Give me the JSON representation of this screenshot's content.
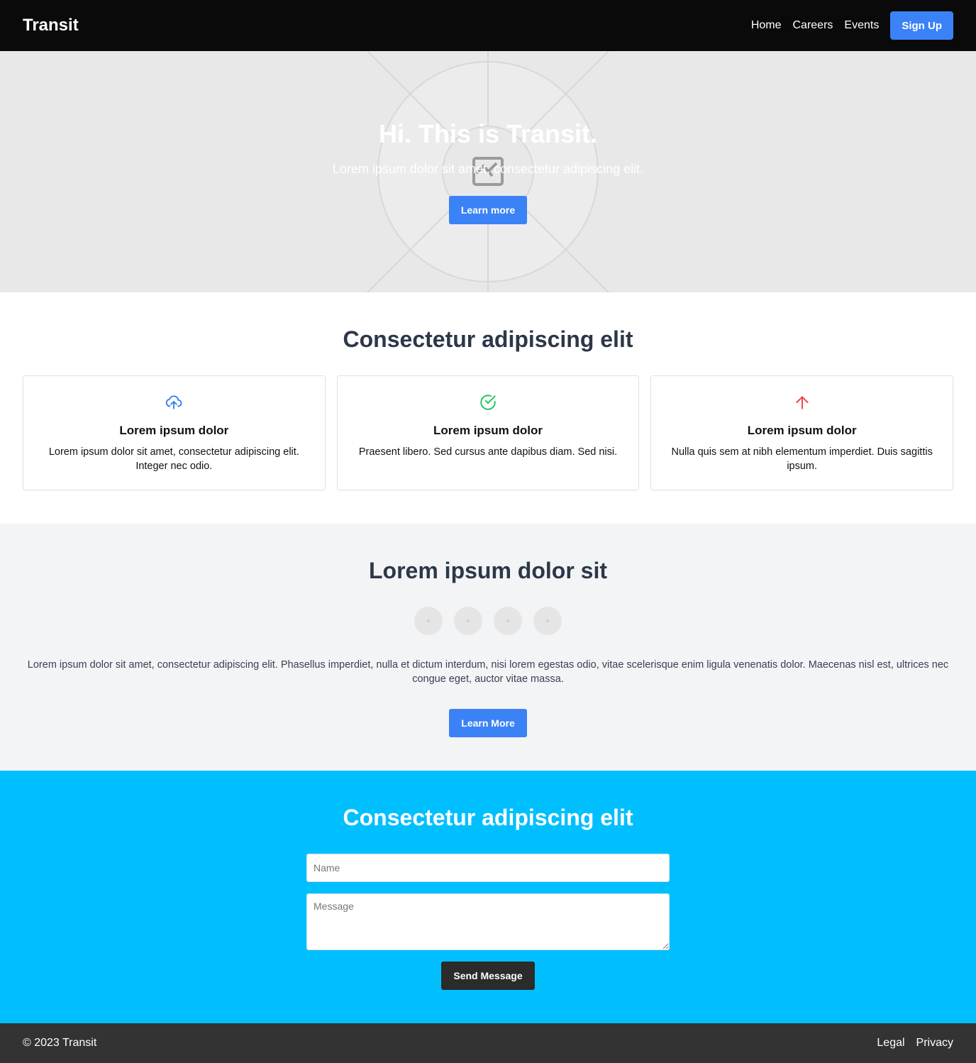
{
  "nav": {
    "brand": "Transit",
    "links": [
      "Home",
      "Careers",
      "Events"
    ],
    "signup_label": "Sign Up"
  },
  "hero": {
    "title": "Hi. This is Transit.",
    "subtitle": "Lorem ipsum dolor sit amet, consectetur adipiscing elit.",
    "button_label": "Learn more",
    "background_icon": "image-placeholder-icon"
  },
  "features": {
    "title": "Consectetur adipiscing elit",
    "cards": [
      {
        "icon": "cloud-upload-icon",
        "icon_color": "#3b82f6",
        "title": "Lorem ipsum dolor",
        "text": "Lorem ipsum dolor sit amet, consectetur adipiscing elit. Integer nec odio."
      },
      {
        "icon": "check-circle-icon",
        "icon_color": "#22c55e",
        "title": "Lorem ipsum dolor",
        "text": "Praesent libero. Sed cursus ante dapibus diam. Sed nisi."
      },
      {
        "icon": "arrow-up-icon",
        "icon_color": "#ef4444",
        "title": "Lorem ipsum dolor",
        "text": "Nulla quis sem at nibh elementum imperdiet. Duis sagittis ipsum."
      }
    ]
  },
  "about": {
    "title": "Lorem ipsum dolor sit",
    "avatar_count": 4,
    "text": "Lorem ipsum dolor sit amet, consectetur adipiscing elit. Phasellus imperdiet, nulla et dictum interdum, nisi lorem egestas odio, vitae scelerisque enim ligula venenatis dolor. Maecenas nisl est, ultrices nec congue eget, auctor vitae massa.",
    "button_label": "Learn More"
  },
  "contact": {
    "title": "Consectetur adipiscing elit",
    "name_placeholder": "Name",
    "message_placeholder": "Message",
    "send_label": "Send Message"
  },
  "footer": {
    "copyright": "© 2023 Transit",
    "links": [
      "Legal",
      "Privacy"
    ]
  },
  "colors": {
    "nav_bg": "#0a0a0a",
    "accent_blue": "#3b82f6",
    "contact_bg": "#00bfff",
    "footer_bg": "#333333"
  }
}
